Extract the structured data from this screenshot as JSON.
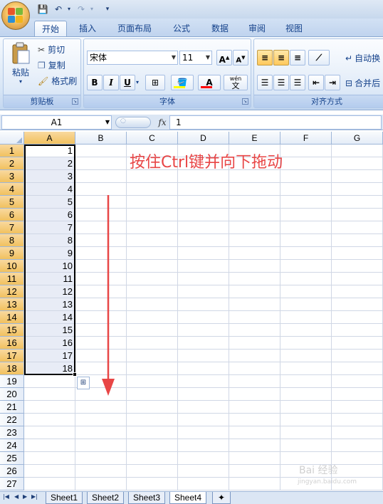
{
  "ribbon_tabs": [
    "开始",
    "插入",
    "页面布局",
    "公式",
    "数据",
    "审阅",
    "视图"
  ],
  "clipboard": {
    "paste_label": "粘贴",
    "cut_label": "剪切",
    "copy_label": "复制",
    "format_painter_label": "格式刷",
    "group_label": "剪贴板"
  },
  "font": {
    "font_name": "宋体",
    "font_size": "11",
    "bold": "B",
    "italic": "I",
    "underline": "U",
    "font_color_glyph": "A",
    "grow_glyph": "A",
    "shrink_glyph": "A",
    "phonetic_glyph": "wén",
    "phonetic_glyph_sub": "文",
    "group_label": "字体"
  },
  "alignment": {
    "wrap_label": "自动换",
    "merge_label": "合并后",
    "group_label": "对齐方式"
  },
  "formula_bar": {
    "name_box": "A1",
    "fx_label": "fx",
    "content": "1"
  },
  "columns": [
    "A",
    "B",
    "C",
    "D",
    "E",
    "F",
    "G"
  ],
  "rows": [
    "1",
    "2",
    "3",
    "4",
    "5",
    "6",
    "7",
    "8",
    "9",
    "10",
    "11",
    "12",
    "13",
    "14",
    "15",
    "16",
    "17",
    "18",
    "19",
    "20",
    "21",
    "22",
    "23",
    "24",
    "25",
    "26",
    "27"
  ],
  "column_a_values": [
    "1",
    "2",
    "3",
    "4",
    "5",
    "6",
    "7",
    "8",
    "9",
    "10",
    "11",
    "12",
    "13",
    "14",
    "15",
    "16",
    "17",
    "18"
  ],
  "annotation": "按住Ctrl键并向下拖动",
  "sheet_tabs": [
    "Sheet1",
    "Sheet2",
    "Sheet3",
    "Sheet4"
  ],
  "active_sheet": "Sheet4",
  "watermark": "Bai 经验",
  "watermark_sub": "jingyan.baidu.com",
  "colors": {
    "annotation": "#e84646",
    "selection_header": "#f1c15f",
    "accent": "#15428b"
  }
}
